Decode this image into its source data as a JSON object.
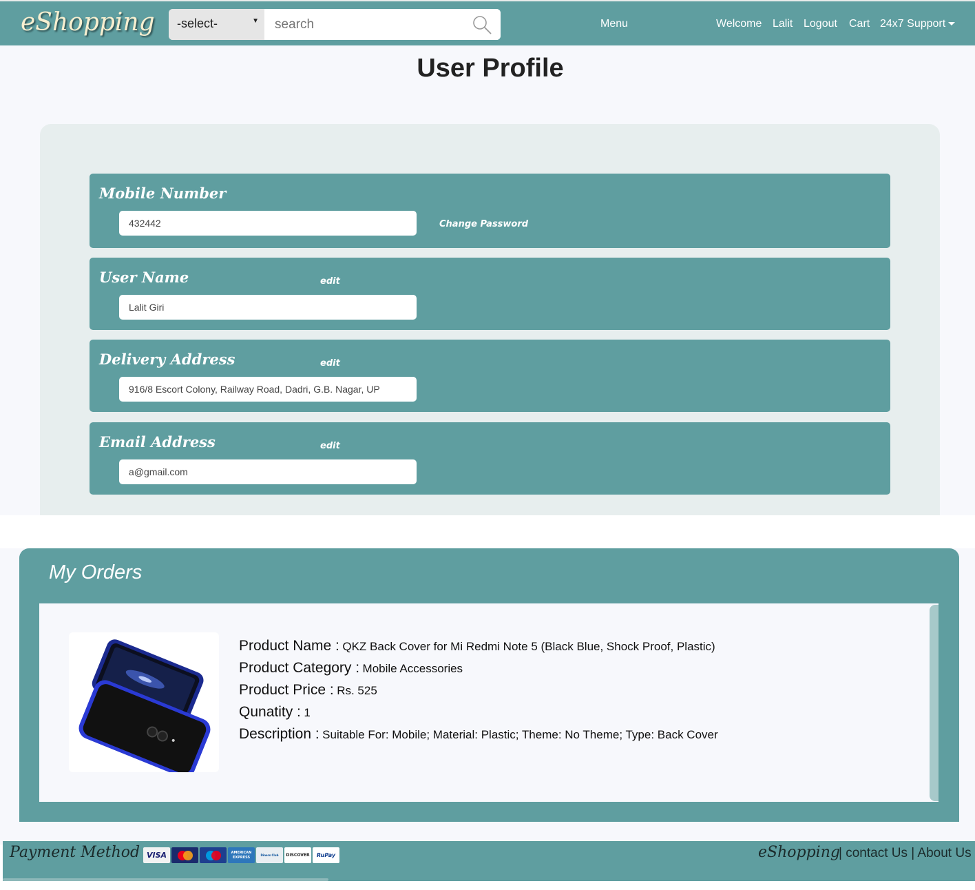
{
  "header": {
    "brand": "eShopping",
    "select_value": "-select-",
    "search_placeholder": "search",
    "nav": {
      "menu": "Menu",
      "welcome": "Welcome",
      "user": "Lalit",
      "logout": "Logout",
      "cart": "Cart",
      "support": "24x7 Support"
    }
  },
  "page": {
    "title": "User Profile"
  },
  "profile": {
    "mobile": {
      "label": "Mobile Number",
      "value": "432442",
      "change_password": "Change Password"
    },
    "username": {
      "label": "User Name",
      "value": "Lalit Giri",
      "edit": "edit"
    },
    "address": {
      "label": "Delivery Address",
      "value": "916/8 Escort Colony, Railway Road, Dadri, G.B. Nagar, UP",
      "edit": "edit"
    },
    "email": {
      "label": "Email Address",
      "value": "a@gmail.com",
      "edit": "edit"
    }
  },
  "orders": {
    "title": "My Orders",
    "items": [
      {
        "name_key": "Product Name :",
        "name": "QKZ Back Cover for Mi Redmi Note 5 (Black Blue, Shock Proof, Plastic)",
        "category_key": "Product Category :",
        "category": "Mobile Accessories",
        "price_key": "Product Price :",
        "price": "Rs. 525",
        "qty_key": "Qunatity :",
        "qty": "1",
        "desc_key": "Description :",
        "desc": "Suitable For: Mobile; Material: Plastic; Theme: No Theme; Type: Back Cover"
      }
    ]
  },
  "footer": {
    "payment_label": "Payment Method",
    "cards": [
      "VISA",
      "MasterCard",
      "Maestro",
      "AMERICAN EXPRESS",
      "Diners Club",
      "DISCOVER",
      "RuPay"
    ],
    "brand": "eShopping",
    "links": "| contact Us | About Us"
  },
  "colors": {
    "teal": "#5f9ea0",
    "panel": "#e7eeee",
    "page": "#f7f8fc"
  }
}
